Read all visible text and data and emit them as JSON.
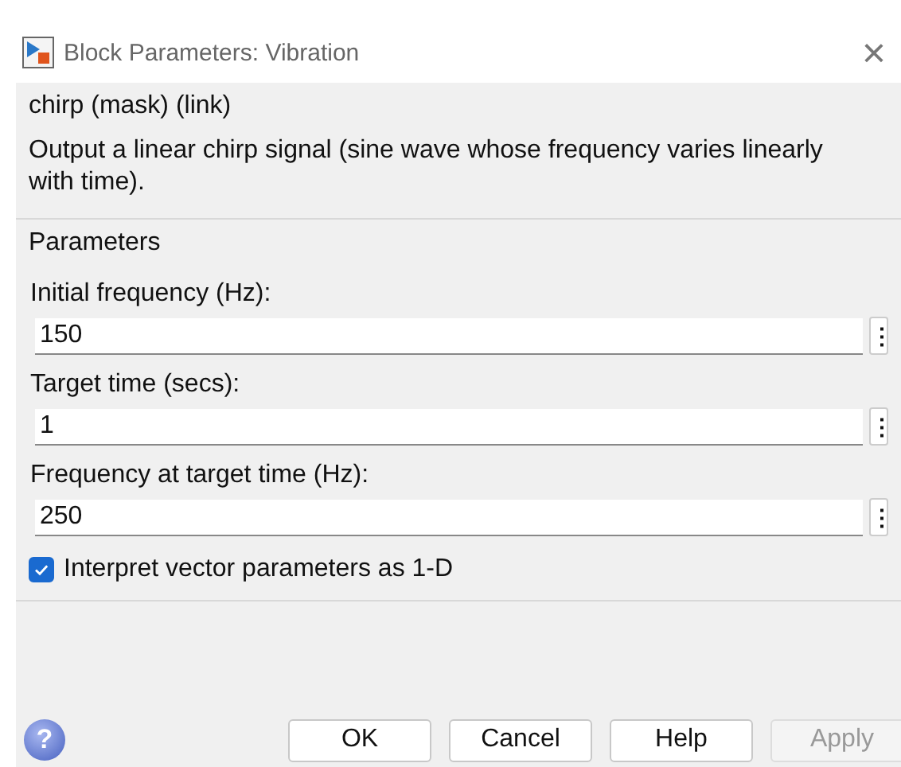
{
  "window": {
    "title": "Block Parameters: Vibration",
    "close": "×"
  },
  "mask": {
    "title": "chirp (mask) (link)",
    "description": "Output a linear chirp signal (sine wave  whose frequency varies linearly with time)."
  },
  "parameters": {
    "title": "Parameters",
    "fields": [
      {
        "label": "Initial frequency (Hz):",
        "value": "150",
        "menu": "⋮"
      },
      {
        "label": "Target time (secs):",
        "value": "1",
        "menu": "⋮"
      },
      {
        "label": "Frequency at target time (Hz):",
        "value": "250",
        "menu": "⋮"
      }
    ],
    "checkbox": {
      "label": "Interpret vector parameters as 1-D",
      "checked": true
    }
  },
  "help_icon": "?",
  "buttons": [
    {
      "label": "OK",
      "disabled": false
    },
    {
      "label": "Cancel",
      "disabled": false
    },
    {
      "label": "Help",
      "disabled": false
    },
    {
      "label": "Apply",
      "disabled": true
    }
  ]
}
